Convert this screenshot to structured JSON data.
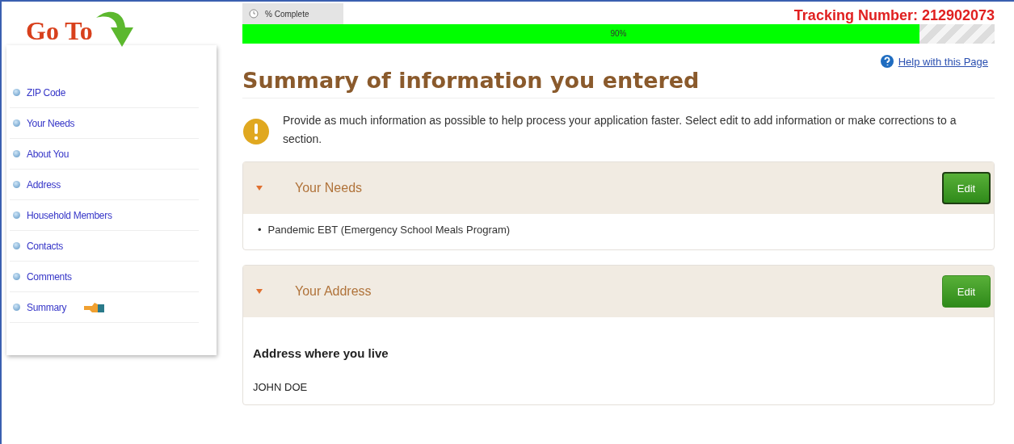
{
  "sidebar": {
    "title": "Go To",
    "items": [
      {
        "label": "ZIP Code",
        "selected": false
      },
      {
        "label": "Your Needs",
        "selected": false
      },
      {
        "label": "About You",
        "selected": false
      },
      {
        "label": "Address",
        "selected": false
      },
      {
        "label": "Household Members",
        "selected": false
      },
      {
        "label": "Contacts",
        "selected": false
      },
      {
        "label": "Comments",
        "selected": false
      },
      {
        "label": "Summary",
        "selected": true
      }
    ]
  },
  "progress": {
    "tab": "% Complete",
    "level": 0.9,
    "reading": "90%"
  },
  "tracking": "Tracking Number: 212902073",
  "help_link": "Help with this Page",
  "heading": "Summary of information you entered",
  "notice": "Provide as much information as possible to help process your application faster. Select edit to add information or make corrections to a section.",
  "sections": [
    {
      "title": "Your Needs",
      "expanded": true,
      "edit": {
        "label": "Edit",
        "focused": true
      },
      "items": [
        {
          "marker": "•",
          "text": "Pandemic EBT (Emergency School Meals Program)"
        }
      ]
    },
    {
      "title": "Your Address",
      "expanded": true,
      "edit": {
        "label": "Edit",
        "focused": false
      },
      "subheading": "Address where you live",
      "lines": [
        "JOHN DOE"
      ]
    }
  ]
}
